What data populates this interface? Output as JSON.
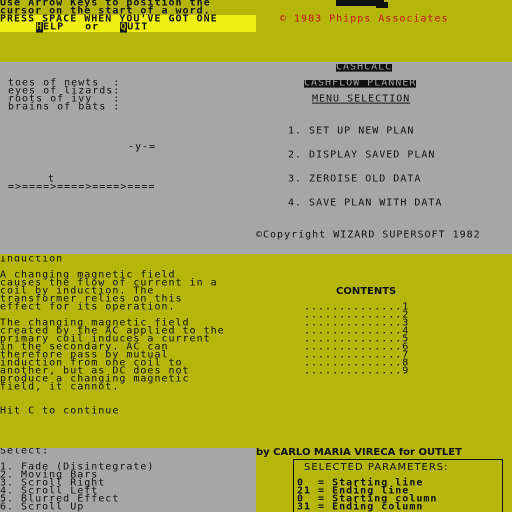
{
  "top": {
    "instructions": [
      "Use Arrow Keys to position the",
      "cursor on the start of a word.",
      "PRESS SPACE WHEN YOU'VE GOT ONE"
    ],
    "help_key": "H",
    "help_rest": "ELP",
    "or_text": "or",
    "quit_key": "Q",
    "quit_rest": "UIT",
    "copyright": "© 1983 Phipps Associates"
  },
  "recipe": {
    "lines": [
      "toes of newts  :",
      "eyes of lizards:",
      "roots of ivy   :",
      "brains of bats :"
    ],
    "marker": "-y-=",
    "t_marker": "t",
    "arrows": "=>====>====>====>===="
  },
  "cashcalc": {
    "title": "CASHCALC",
    "subtitle": "CASHFLOW PLANNER",
    "menu_title": "MENU SELECTION",
    "options": [
      "1. SET UP NEW PLAN",
      "2. DISPLAY SAVED PLAN",
      "3. ZEROISE OLD DATA",
      "4. SAVE PLAN WITH DATA"
    ],
    "copyright": "©Copyright WIZARD SUPERSOFT 1982"
  },
  "induction": {
    "title": "Induction",
    "para1": [
      "A changing magnetic field",
      "causes the flow of current in a",
      "coil by induction. The",
      "transformer relies on this",
      "effect for its operation."
    ],
    "para2": [
      "The changing magnetic field",
      "created by the AC applied to the",
      "primary coil induces a current",
      "in the secondary. AC can",
      "therefore pass by mutual",
      "induction from one coil to",
      "another, but as DC does not",
      "produce a changing magnetic",
      "field, it cannot."
    ],
    "continue": "Hit C to continue"
  },
  "contents": {
    "title": "CONTENTS",
    "leader": "..............",
    "numbers": [
      "1",
      "2",
      "3",
      "4",
      "5",
      "6",
      "7",
      "8",
      "9"
    ]
  },
  "select": {
    "title": "Select:",
    "items": [
      "1. Fade (Disintegrate)",
      "2. Moving Bars",
      "3. Scroll Right",
      "4. Scroll Left",
      "5. Blurred Effect",
      "6. Scroll Up"
    ]
  },
  "params": {
    "byline": "by CARLO MARIA VIRECA for OUTLET",
    "title": "SELECTED PARAMETERS:",
    "rows": [
      "0  = Starting line",
      "21 = Ending line",
      "0  = Starting column",
      "31 = Ending column"
    ]
  },
  "colors": {
    "yellow": "#b5b50a",
    "gray": "#a6a6a6",
    "black": "#111111",
    "red": "#c01818"
  }
}
